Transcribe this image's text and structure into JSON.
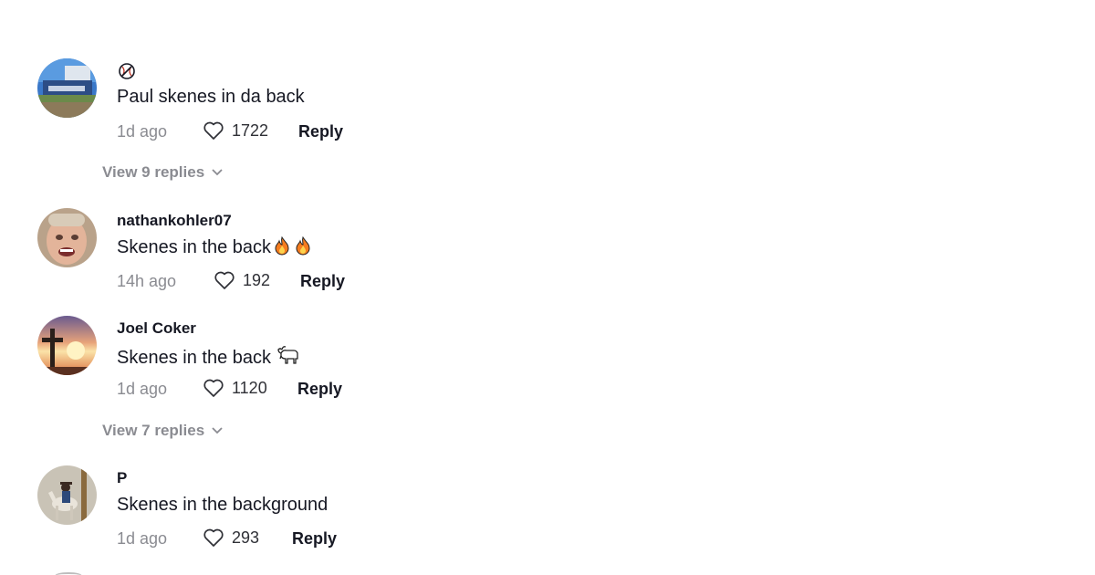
{
  "comments": [
    {
      "username": "",
      "username_badge": "baseball-icon",
      "text": "Paul skenes in da back",
      "text_emoji": "",
      "time": "1d ago",
      "likes": "1722",
      "reply_label": "Reply",
      "view_replies": "View 9 replies",
      "avatar": "stadium-avatar"
    },
    {
      "username": "nathankohler07",
      "text": "Skenes in the back",
      "text_emoji": "fire-fire",
      "time": "14h ago",
      "likes": "192",
      "reply_label": "Reply",
      "avatar": "face-avatar"
    },
    {
      "username": "Joel Coker",
      "text": "Skenes in the back",
      "text_emoji": "goat",
      "time": "1d ago",
      "likes": "1120",
      "reply_label": "Reply",
      "view_replies": "View 7 replies",
      "avatar": "cross-sunset-avatar"
    },
    {
      "username": "P",
      "text": "Skenes in the background",
      "text_emoji": "",
      "time": "1d ago",
      "likes": "293",
      "reply_label": "Reply",
      "avatar": "horse-rider-avatar"
    }
  ],
  "colors": {
    "primary_text": "#161823",
    "secondary_text": "#8a8b91",
    "background": "#ffffff"
  }
}
